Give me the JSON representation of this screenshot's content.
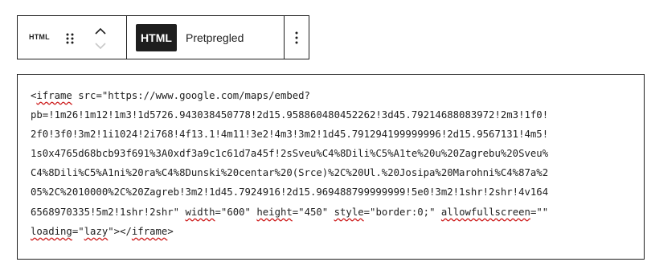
{
  "toolbar": {
    "block_type_label": "HTML",
    "block_type_icon": "html-block-icon",
    "drag_icon": "drag-handle-icon",
    "move_up_icon": "chevron-up-icon",
    "move_down_icon": "chevron-down-icon",
    "tabs": [
      {
        "label": "HTML",
        "active": true
      },
      {
        "label": "Pretpregled",
        "active": false
      }
    ],
    "more_icon": "more-vertical-icon"
  },
  "editor": {
    "lines": [
      [
        {
          "t": "<"
        },
        {
          "t": "iframe",
          "u": true
        },
        {
          "t": " src=\"https://www.google.com/maps/embed?"
        }
      ],
      [
        {
          "t": "pb=!1m26!1m12!1m3!1d5726.943038450778!2d15.958860480452262!3d45.79214688083972!2m3!1f0!"
        }
      ],
      [
        {
          "t": "2f0!3f0!3m2!1i1024!2i768!4f13.1!4m11!3e2!4m3!3m2!1d45.791294199999996!2d15.9567131!4m5!"
        }
      ],
      [
        {
          "t": "1s0x4765d68bcb93f691%3A0xdf3a9c1c61d7a45f!2sSveu%C4%8Dili%C5%A1te%20u%20Zagrebu%20Sveu%"
        }
      ],
      [
        {
          "t": "C4%8Dili%C5%A1ni%20ra%C4%8Dunski%20centar%20(Srce)%2C%20Ul.%20Josipa%20Marohni%C4%87a%2"
        }
      ],
      [
        {
          "t": "05%2C%2010000%2C%20Zagreb!3m2!1d45.7924916!2d15.969488799999999!5e0!3m2!1shr!2shr!4v164"
        }
      ],
      [
        {
          "t": "6568970335!5m2!1shr!2shr\" "
        },
        {
          "t": "width",
          "u": true
        },
        {
          "t": "=\"600\" "
        },
        {
          "t": "height",
          "u": true
        },
        {
          "t": "=\"450\" "
        },
        {
          "t": "style",
          "u": true
        },
        {
          "t": "=\"border:0;\" "
        },
        {
          "t": "allowfullscreen",
          "u": true
        },
        {
          "t": "=\"\""
        }
      ],
      [
        {
          "t": "loading",
          "u": true
        },
        {
          "t": "=\""
        },
        {
          "t": "lazy",
          "u": true
        },
        {
          "t": "\"></"
        },
        {
          "t": "iframe",
          "u": true
        },
        {
          "t": ">"
        }
      ]
    ]
  },
  "colors": {
    "border": "#1e1e1e",
    "active_tab_bg": "#1e1e1e",
    "active_tab_text": "#ffffff",
    "spellcheck_underline": "#cc1818"
  }
}
